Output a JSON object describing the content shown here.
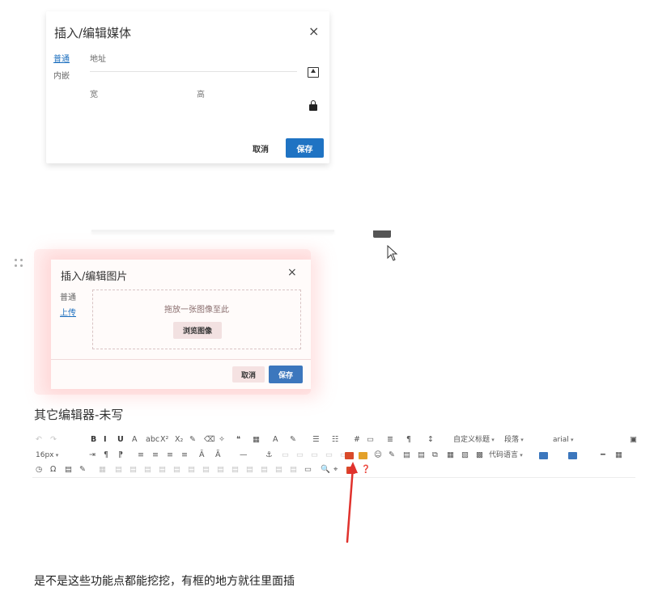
{
  "media_dialog": {
    "title": "插入/编辑媒体",
    "close_glyph": "×",
    "tabs": [
      "普通",
      "内嵌"
    ],
    "url_label": "地址",
    "width_label": "宽",
    "height_label": "高",
    "cancel_label": "取消",
    "save_label": "保存",
    "icons": [
      "upload-icon",
      "lock-icon"
    ],
    "accent": "#1f73c3"
  },
  "image_dialog": {
    "title": "插入/编辑图片",
    "close_glyph": "×",
    "tabs": [
      "普通",
      "上传"
    ],
    "drop_text": "拖放一张图像至此",
    "browse_label": "浏览图像",
    "cancel_label": "取消",
    "save_label": "保存",
    "accent": "#3c77bd"
  },
  "section_heading": "其它编辑器-未写",
  "toolbar": {
    "row1": {
      "glyphs": [
        "↶",
        "↷",
        "B",
        "I",
        "U",
        "A",
        "abc",
        "X²",
        "X₂",
        "✎",
        "⌫",
        "✧",
        "❝",
        "▦",
        "A",
        "✎",
        "☰",
        "☷",
        "#",
        "▭",
        "≣",
        "¶",
        "↕",
        "▣"
      ],
      "custom_heading": "自定义标题",
      "paragraph": "段落",
      "font_family": "arial"
    },
    "row2": {
      "font_size": "16px",
      "glyphs": [
        "⇥",
        "¶",
        "⁋",
        "≡",
        "≡",
        "≡",
        "≡",
        "Ā",
        "Ã",
        "—",
        "⚓",
        "▭",
        "▭",
        "▭",
        "▭",
        "▭",
        "☺",
        "✎",
        "▤",
        "▤",
        "⧉",
        "▦",
        "▧",
        "▩",
        "━",
        "▦"
      ],
      "code_language": "代码语言"
    },
    "row3": {
      "glyphs": [
        "◷",
        "Ω",
        "▤",
        "✎",
        "▦",
        "▤",
        "▤",
        "▤",
        "▤",
        "▤",
        "▤",
        "▤",
        "▤",
        "▤",
        "▤",
        "▤",
        "▤",
        "▤",
        "▭",
        "🔍",
        "⌖",
        "❓"
      ]
    },
    "image_icon_colors": [
      "#d94a2a",
      "#e3a12a",
      "#3e8e3e",
      "#3c77bd"
    ]
  },
  "bottom_note": "是不是这些功能点都能挖挖，有框的地方就往里面插"
}
